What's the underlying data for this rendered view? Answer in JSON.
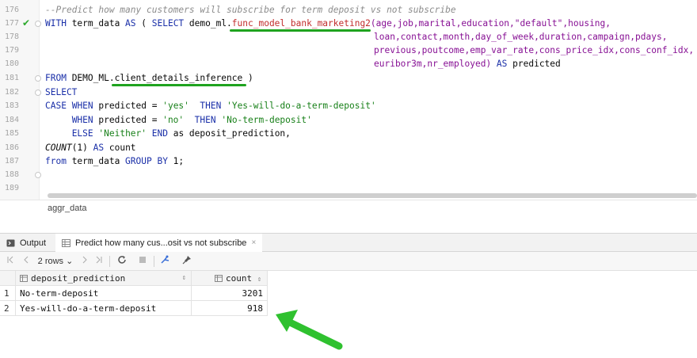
{
  "editor": {
    "line_numbers": [
      "176",
      "177",
      "178",
      "179",
      "180",
      "181",
      "182",
      "183",
      "184",
      "185",
      "186",
      "187",
      "188",
      "189"
    ],
    "line176": {
      "comment": "--Predict how many customers will subscribe for term deposit vs not subscribe"
    },
    "line177": {
      "kw_with": "WITH",
      "name": " term_data ",
      "kw_as": "AS",
      "p1": " ( ",
      "kw_select": "SELECT",
      "p2": " demo_ml.",
      "func": "func_model_bank_marketing2",
      "args": "(age,job,marital,education,\"default\",housing,"
    },
    "line178": {
      "args": "loan,contact,month,day_of_week,duration,campaign,pdays,"
    },
    "line179": {
      "args": "previous,poutcome,emp_var_rate,cons_price_idx,cons_conf_idx,"
    },
    "line180": {
      "args": "euribor3m,nr_employed) ",
      "kw_as": "AS",
      "alias": " predicted"
    },
    "line181": {
      "kw_from": "FROM",
      "schema": " DEMO_ML.",
      "table": "client_details_inference",
      "close": " )"
    },
    "line182": {
      "kw_select": "SELECT"
    },
    "line183": {
      "kw_case": "CASE",
      "kw_when": "WHEN",
      "col": " predicted = ",
      "s1": "'yes'",
      "kw_then": "THEN",
      "s2": "'Yes-will-do-a-term-deposit'"
    },
    "line184": {
      "kw_when": "WHEN",
      "col": " predicted = ",
      "s1": "'no'",
      "kw_then": "THEN",
      "s2": "'No-term-deposit'"
    },
    "line185": {
      "kw_else": "ELSE",
      "s1": "'Neither'",
      "kw_end": "END",
      "rest": " as deposit_prediction,"
    },
    "line186": {
      "fn": "COUNT",
      "rest": "(1) ",
      "kw_as": "AS",
      "alias": " count"
    },
    "line187": {
      "kw_from": "from",
      "rest": " term_data ",
      "kw_group": "GROUP BY",
      "end": " 1;"
    }
  },
  "breadcrumb": {
    "label": "aggr_data"
  },
  "tool_tabs": {
    "output": "Output",
    "result": "Predict how many cus...osit vs not subscribe",
    "close": "×"
  },
  "toolbar": {
    "rows_label": "2 rows",
    "rows_caret": "⌄"
  },
  "grid": {
    "columns": [
      {
        "name": "deposit_prediction",
        "sort": "⇕"
      },
      {
        "name": "count",
        "sort": "⇕"
      }
    ],
    "rows": [
      {
        "n": "1",
        "deposit_prediction": "No-term-deposit",
        "count": "3201"
      },
      {
        "n": "2",
        "deposit_prediction": "Yes-will-do-a-term-deposit",
        "count": "918"
      }
    ]
  },
  "colors": {
    "keyword": "#1a2fa8",
    "string": "#188019",
    "function": "#c22d2d",
    "annotation": "#1fa31f",
    "success": "#2eaa2e"
  },
  "icons": [
    "check-icon",
    "output-icon",
    "table-icon",
    "first-page-icon",
    "prev-page-icon",
    "next-page-icon",
    "last-page-icon",
    "refresh-icon",
    "stop-icon",
    "pin-tab-icon",
    "pin-icon",
    "column-icon",
    "arrow-icon"
  ]
}
